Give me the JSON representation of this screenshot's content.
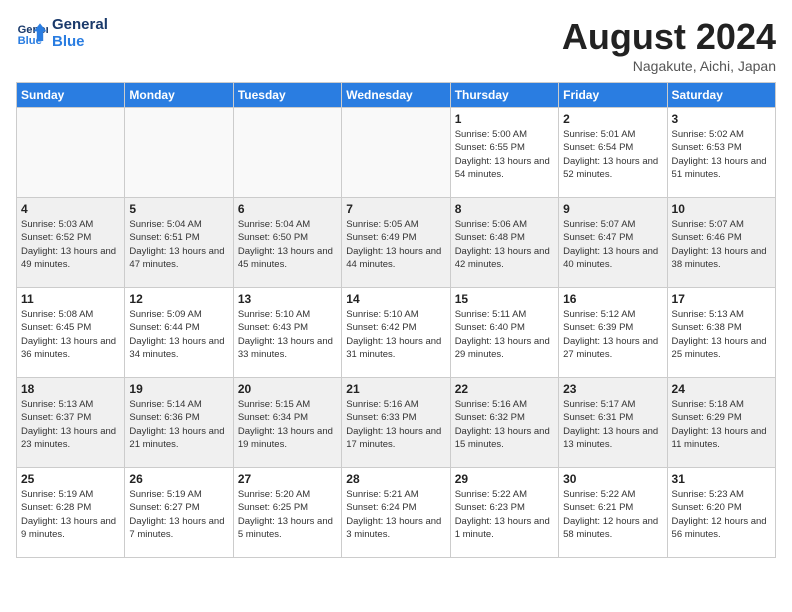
{
  "header": {
    "logo_line1": "General",
    "logo_line2": "Blue",
    "month_title": "August 2024",
    "location": "Nagakute, Aichi, Japan"
  },
  "weekdays": [
    "Sunday",
    "Monday",
    "Tuesday",
    "Wednesday",
    "Thursday",
    "Friday",
    "Saturday"
  ],
  "weeks": [
    [
      {
        "num": "",
        "info": "",
        "empty": true
      },
      {
        "num": "",
        "info": "",
        "empty": true
      },
      {
        "num": "",
        "info": "",
        "empty": true
      },
      {
        "num": "",
        "info": "",
        "empty": true
      },
      {
        "num": "1",
        "info": "Sunrise: 5:00 AM\nSunset: 6:55 PM\nDaylight: 13 hours\nand 54 minutes."
      },
      {
        "num": "2",
        "info": "Sunrise: 5:01 AM\nSunset: 6:54 PM\nDaylight: 13 hours\nand 52 minutes."
      },
      {
        "num": "3",
        "info": "Sunrise: 5:02 AM\nSunset: 6:53 PM\nDaylight: 13 hours\nand 51 minutes."
      }
    ],
    [
      {
        "num": "4",
        "info": "Sunrise: 5:03 AM\nSunset: 6:52 PM\nDaylight: 13 hours\nand 49 minutes."
      },
      {
        "num": "5",
        "info": "Sunrise: 5:04 AM\nSunset: 6:51 PM\nDaylight: 13 hours\nand 47 minutes."
      },
      {
        "num": "6",
        "info": "Sunrise: 5:04 AM\nSunset: 6:50 PM\nDaylight: 13 hours\nand 45 minutes."
      },
      {
        "num": "7",
        "info": "Sunrise: 5:05 AM\nSunset: 6:49 PM\nDaylight: 13 hours\nand 44 minutes."
      },
      {
        "num": "8",
        "info": "Sunrise: 5:06 AM\nSunset: 6:48 PM\nDaylight: 13 hours\nand 42 minutes."
      },
      {
        "num": "9",
        "info": "Sunrise: 5:07 AM\nSunset: 6:47 PM\nDaylight: 13 hours\nand 40 minutes."
      },
      {
        "num": "10",
        "info": "Sunrise: 5:07 AM\nSunset: 6:46 PM\nDaylight: 13 hours\nand 38 minutes."
      }
    ],
    [
      {
        "num": "11",
        "info": "Sunrise: 5:08 AM\nSunset: 6:45 PM\nDaylight: 13 hours\nand 36 minutes."
      },
      {
        "num": "12",
        "info": "Sunrise: 5:09 AM\nSunset: 6:44 PM\nDaylight: 13 hours\nand 34 minutes."
      },
      {
        "num": "13",
        "info": "Sunrise: 5:10 AM\nSunset: 6:43 PM\nDaylight: 13 hours\nand 33 minutes."
      },
      {
        "num": "14",
        "info": "Sunrise: 5:10 AM\nSunset: 6:42 PM\nDaylight: 13 hours\nand 31 minutes."
      },
      {
        "num": "15",
        "info": "Sunrise: 5:11 AM\nSunset: 6:40 PM\nDaylight: 13 hours\nand 29 minutes."
      },
      {
        "num": "16",
        "info": "Sunrise: 5:12 AM\nSunset: 6:39 PM\nDaylight: 13 hours\nand 27 minutes."
      },
      {
        "num": "17",
        "info": "Sunrise: 5:13 AM\nSunset: 6:38 PM\nDaylight: 13 hours\nand 25 minutes."
      }
    ],
    [
      {
        "num": "18",
        "info": "Sunrise: 5:13 AM\nSunset: 6:37 PM\nDaylight: 13 hours\nand 23 minutes."
      },
      {
        "num": "19",
        "info": "Sunrise: 5:14 AM\nSunset: 6:36 PM\nDaylight: 13 hours\nand 21 minutes."
      },
      {
        "num": "20",
        "info": "Sunrise: 5:15 AM\nSunset: 6:34 PM\nDaylight: 13 hours\nand 19 minutes."
      },
      {
        "num": "21",
        "info": "Sunrise: 5:16 AM\nSunset: 6:33 PM\nDaylight: 13 hours\nand 17 minutes."
      },
      {
        "num": "22",
        "info": "Sunrise: 5:16 AM\nSunset: 6:32 PM\nDaylight: 13 hours\nand 15 minutes."
      },
      {
        "num": "23",
        "info": "Sunrise: 5:17 AM\nSunset: 6:31 PM\nDaylight: 13 hours\nand 13 minutes."
      },
      {
        "num": "24",
        "info": "Sunrise: 5:18 AM\nSunset: 6:29 PM\nDaylight: 13 hours\nand 11 minutes."
      }
    ],
    [
      {
        "num": "25",
        "info": "Sunrise: 5:19 AM\nSunset: 6:28 PM\nDaylight: 13 hours\nand 9 minutes."
      },
      {
        "num": "26",
        "info": "Sunrise: 5:19 AM\nSunset: 6:27 PM\nDaylight: 13 hours\nand 7 minutes."
      },
      {
        "num": "27",
        "info": "Sunrise: 5:20 AM\nSunset: 6:25 PM\nDaylight: 13 hours\nand 5 minutes."
      },
      {
        "num": "28",
        "info": "Sunrise: 5:21 AM\nSunset: 6:24 PM\nDaylight: 13 hours\nand 3 minutes."
      },
      {
        "num": "29",
        "info": "Sunrise: 5:22 AM\nSunset: 6:23 PM\nDaylight: 13 hours\nand 1 minute."
      },
      {
        "num": "30",
        "info": "Sunrise: 5:22 AM\nSunset: 6:21 PM\nDaylight: 12 hours\nand 58 minutes."
      },
      {
        "num": "31",
        "info": "Sunrise: 5:23 AM\nSunset: 6:20 PM\nDaylight: 12 hours\nand 56 minutes."
      }
    ]
  ]
}
